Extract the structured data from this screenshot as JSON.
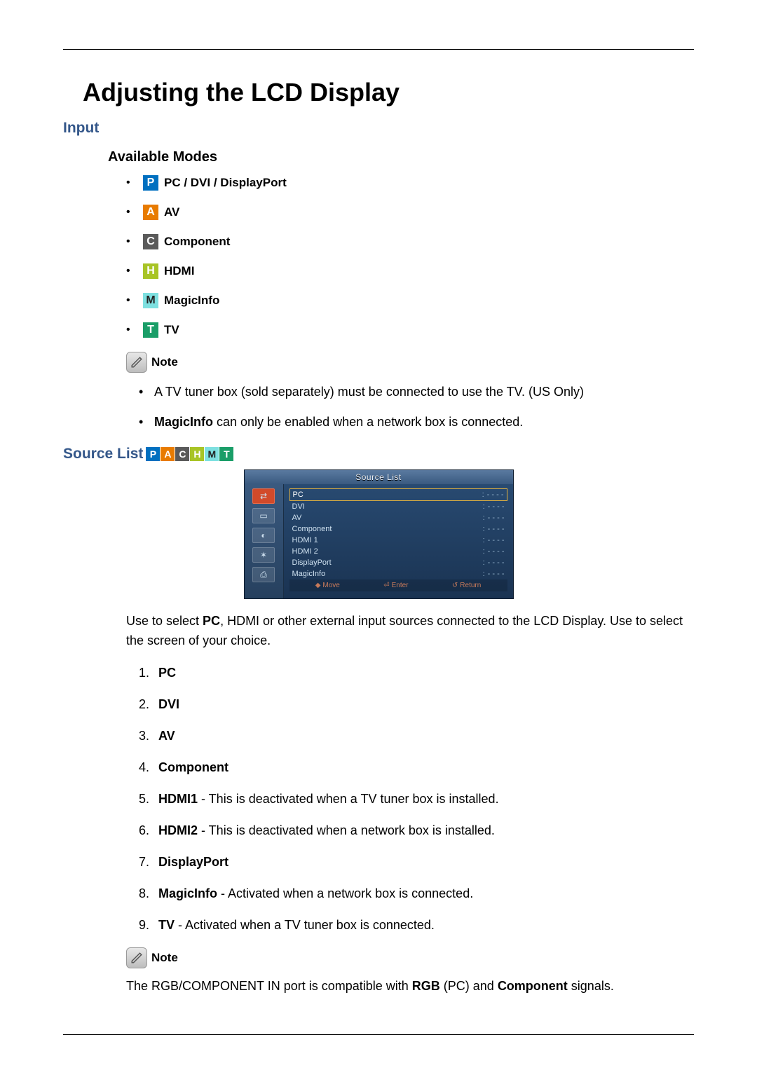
{
  "title": "Adjusting the LCD Display",
  "section_input": "Input",
  "sub_available_modes": "Available Modes",
  "modes": [
    {
      "letter": "P",
      "cls": "chip-P",
      "label": "PC / DVI / DisplayPort"
    },
    {
      "letter": "A",
      "cls": "chip-A",
      "label": "AV"
    },
    {
      "letter": "C",
      "cls": "chip-C",
      "label": "Component"
    },
    {
      "letter": "H",
      "cls": "chip-H",
      "label": "HDMI"
    },
    {
      "letter": "M",
      "cls": "chip-M",
      "label": "MagicInfo"
    },
    {
      "letter": "T",
      "cls": "chip-T",
      "label": "TV"
    }
  ],
  "note_label": "Note",
  "note1_items": {
    "tv": "A TV tuner box (sold separately) must be connected to use the TV. (US Only)",
    "magicinfo_bold": "MagicInfo",
    "magicinfo_rest": " can only be enabled when a network box is connected."
  },
  "source_list_heading": "Source List",
  "osd": {
    "header": "Source List",
    "rows": [
      {
        "name": "PC",
        "val": "- - - -",
        "sel": true
      },
      {
        "name": "DVI",
        "val": "- - - -"
      },
      {
        "name": "AV",
        "val": "- - - -"
      },
      {
        "name": "Component",
        "val": "- - - -"
      },
      {
        "name": "HDMI 1",
        "val": "- - - -"
      },
      {
        "name": "HDMI 2",
        "val": "- - - -"
      },
      {
        "name": "DisplayPort",
        "val": "- - - -"
      },
      {
        "name": "MagicInfo",
        "val": "- - - -"
      }
    ],
    "footer": {
      "move": "Move",
      "enter": "Enter",
      "ret": "Return"
    }
  },
  "source_desc_pre": "Use to select ",
  "source_desc_bold": "PC",
  "source_desc_post": ", HDMI or other external input sources connected to the LCD Display. Use to select the screen of your choice.",
  "numbered": {
    "i1": "PC",
    "i2": "DVI",
    "i3": "AV",
    "i4": "Component",
    "i5b": "HDMI1",
    "i5r": " - This is deactivated when a TV tuner box is installed.",
    "i6b": "HDMI2",
    "i6r": " - This is deactivated when a network box is installed.",
    "i7": "DisplayPort",
    "i8b": "MagicInfo",
    "i8r": " - Activated when a network box is connected.",
    "i9b": "TV",
    "i9r": " - Activated when a TV tuner box is connected."
  },
  "final_note_pre": "The RGB/COMPONENT IN port is compatible with ",
  "final_note_b1": "RGB",
  "final_note_mid1": " (PC) and ",
  "final_note_b2": "Component",
  "final_note_post": " signals."
}
